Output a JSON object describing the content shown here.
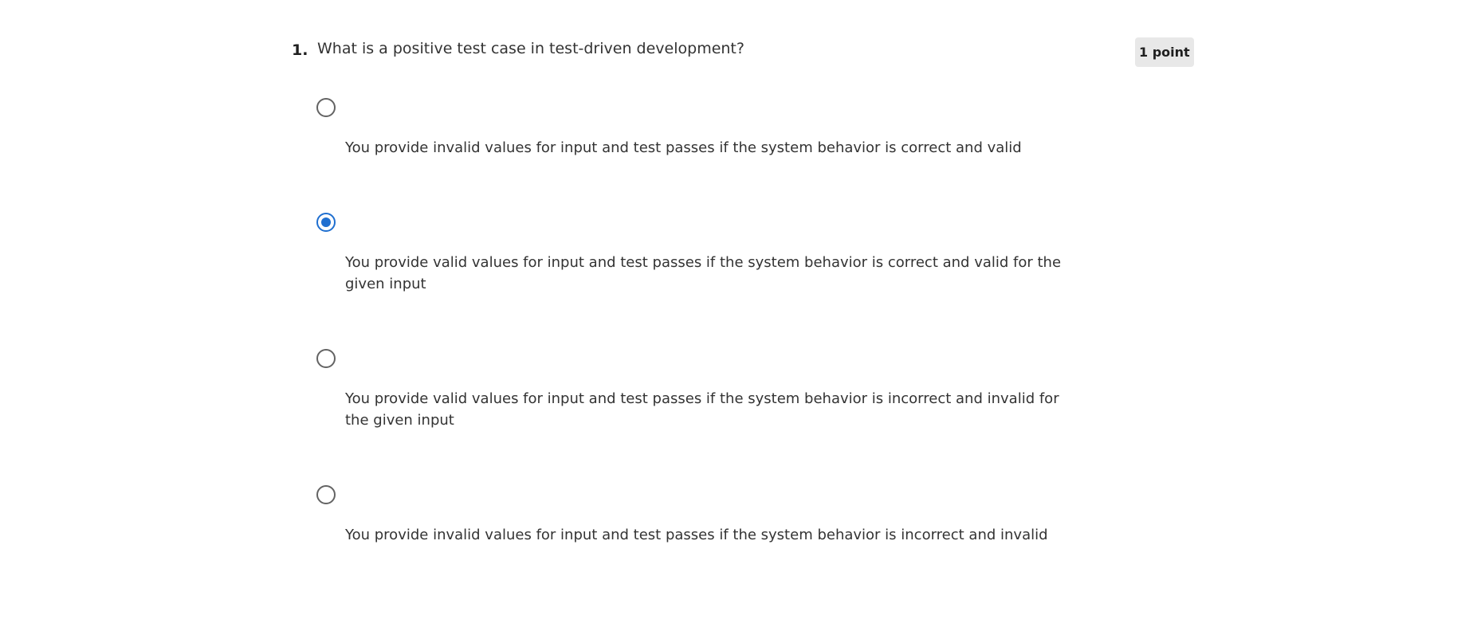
{
  "question": {
    "number": "1.",
    "text": "What is a positive test case in test-driven development?",
    "points": "1 point",
    "options": [
      {
        "label": "You provide invalid values for input and test passes if the system behavior is correct and valid",
        "selected": false
      },
      {
        "label": "You provide valid values for input and test passes if the system behavior is correct and valid  for the given input",
        "selected": true
      },
      {
        "label": "You provide valid values for input and test passes if the system behavior is incorrect and invalid for the given input",
        "selected": false
      },
      {
        "label": "You provide invalid values for input and test passes if the system behavior is incorrect and invalid",
        "selected": false
      }
    ]
  },
  "colors": {
    "accent": "#1f6fd0",
    "radio_border": "#636363",
    "text": "#333333",
    "badge_bg": "#e8e8e8"
  }
}
